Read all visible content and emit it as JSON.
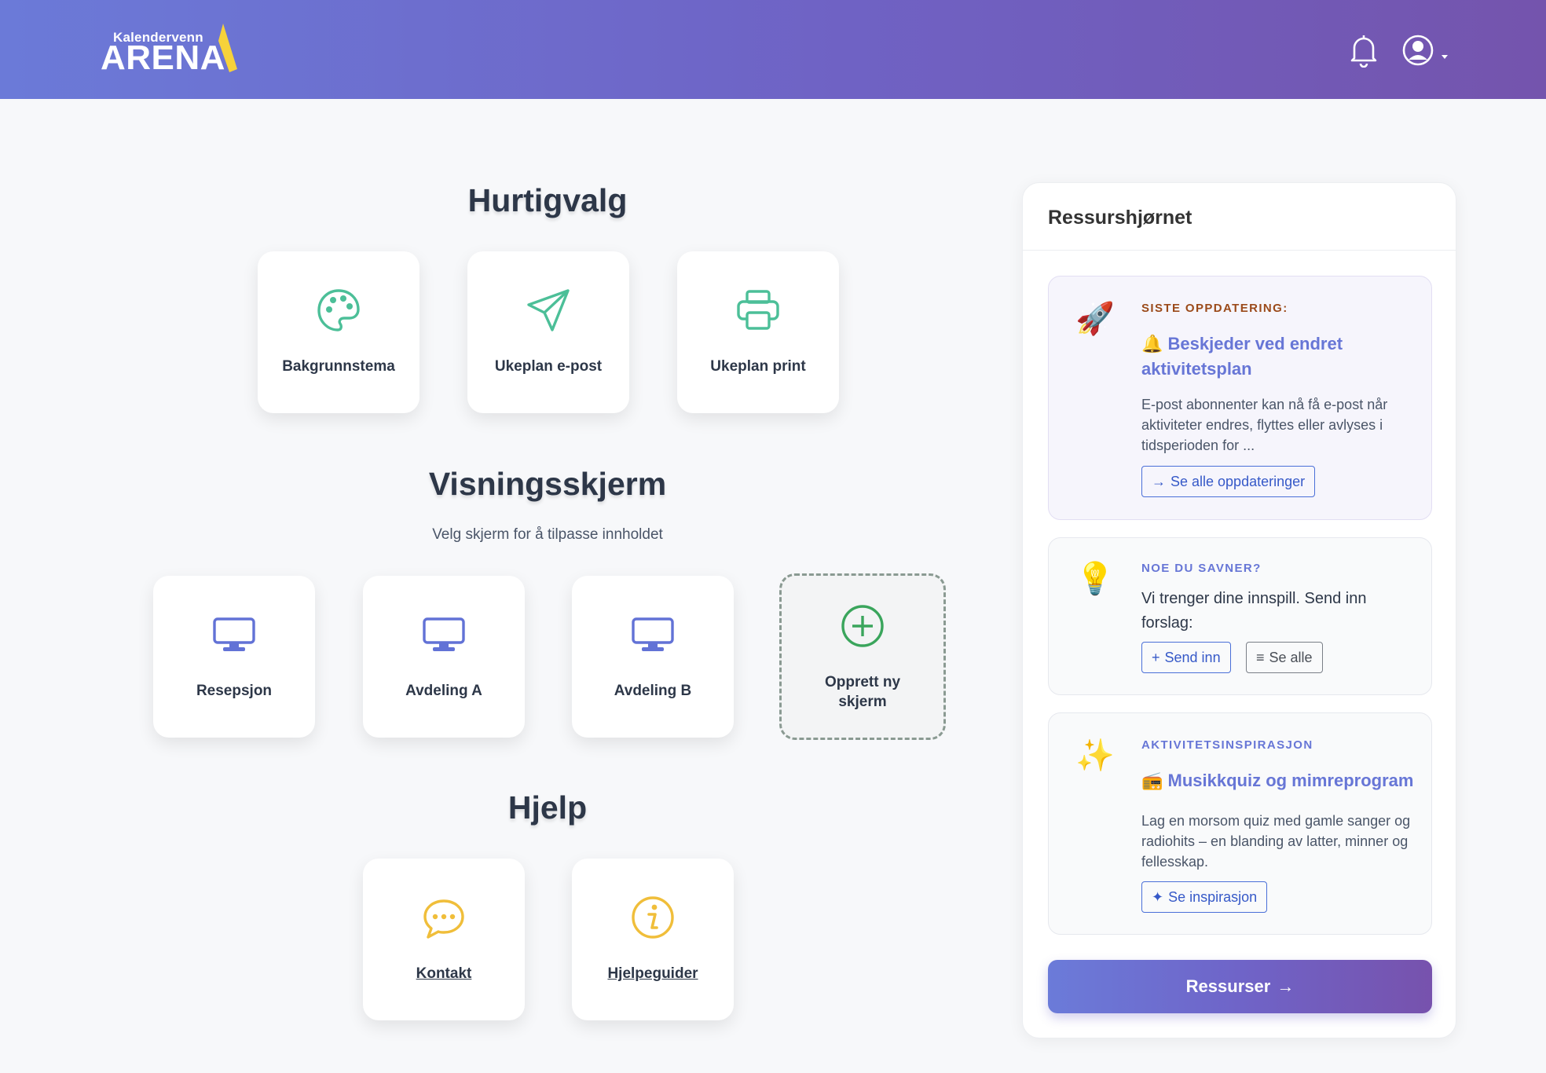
{
  "header": {
    "logo_small": "Kalendervenn",
    "logo_big": "ARENA",
    "bell_icon": "bell-icon",
    "user_icon": "user-circle-icon"
  },
  "quick": {
    "title": "Hurtigvalg",
    "tiles": [
      {
        "label": "Bakgrunnstema",
        "icon": "palette-icon"
      },
      {
        "label": "Ukeplan e-post",
        "icon": "paper-plane-icon"
      },
      {
        "label": "Ukeplan print",
        "icon": "printer-icon"
      }
    ]
  },
  "screens": {
    "title": "Visningsskjerm",
    "subtitle": "Velg skjerm for å tilpasse innholdet",
    "tiles": [
      {
        "label": "Resepsjon",
        "icon": "monitor-icon"
      },
      {
        "label": "Avdeling A",
        "icon": "monitor-icon"
      },
      {
        "label": "Avdeling B",
        "icon": "monitor-icon"
      }
    ],
    "create_line1": "Opprett ny",
    "create_line2": "skjerm"
  },
  "help": {
    "title": "Hjelp",
    "tiles": [
      {
        "label": "Kontakt",
        "icon": "chat-bubble-icon"
      },
      {
        "label": "Hjelpeguider",
        "icon": "info-icon"
      }
    ]
  },
  "resources": {
    "title": "Ressurshjørnet",
    "update": {
      "emoji": "🚀",
      "kicker": "SISTE OPPDATERING:",
      "title": "🔔 Beskjeder ved endret aktivitetsplan",
      "text": "E-post abonnenter kan nå få e-post når aktiviteter endres, flyttes eller avlyses i tidsperioden for ...",
      "button": "Se alle oppdateringer"
    },
    "missing": {
      "emoji": "💡",
      "kicker": "NOE DU SAVNER?",
      "text": "Vi trenger dine innspill. Send inn forslag:",
      "send_button": "Send inn",
      "all_button": "Se alle"
    },
    "inspiration": {
      "emoji": "✨",
      "kicker": "AKTIVITETSINSPIRASJON",
      "title": "📻 Musikkquiz og mimreprogram",
      "text": "Lag en morsom quiz med gamle sanger og radiohits – en blanding av latter, minner og fellesskap.",
      "button": "Se inspirasjon"
    },
    "main_button": "Ressurser"
  },
  "colors": {
    "header_start": "#6b7ad8",
    "header_end": "#7454ad",
    "quick_icon": "#4cbf98",
    "screen_icon": "#6272d6",
    "create_icon": "#3aa55c",
    "help_icon": "#f0be3a",
    "kicker_update": "#9b4a1a",
    "kicker_other": "#6776d6"
  }
}
